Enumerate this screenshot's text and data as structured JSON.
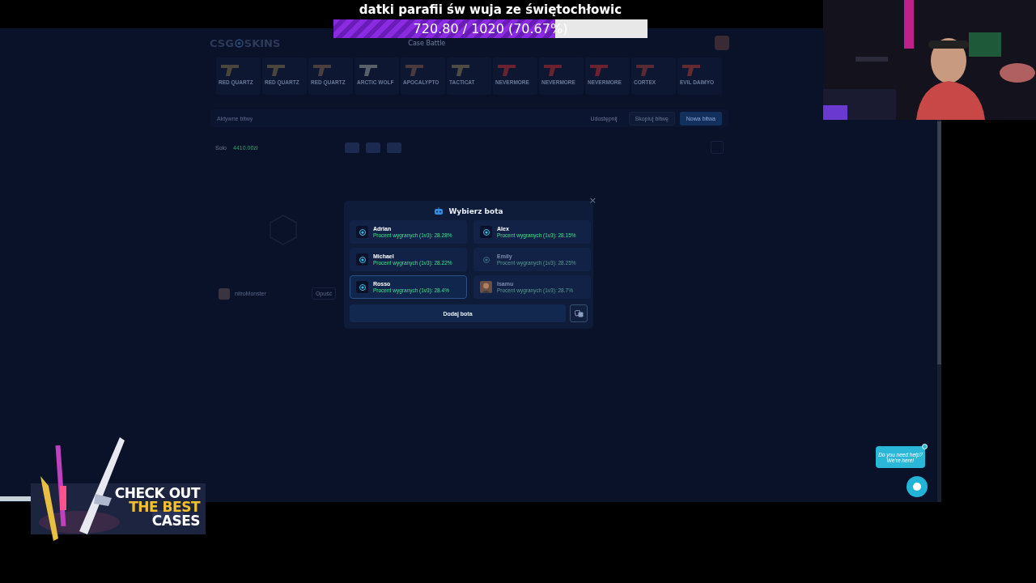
{
  "stream_overlay": {
    "goal_title": "datki parafii św wuja ze świętochłowic",
    "goal_progress": {
      "text": "720.80 / 1020 (70.67%)",
      "level": 0.7067
    }
  },
  "site": {
    "logo": {
      "left": "CSG",
      "right": "SKINS"
    },
    "nav": [
      {
        "label": "Case Battle",
        "selected": true
      }
    ],
    "skins": [
      {
        "name": "RED QUARTZ",
        "color": "#4a463e"
      },
      {
        "name": "RED QUARTZ",
        "color": "#4a463e"
      },
      {
        "name": "RED QUARTZ",
        "color": "#4a3e3e"
      },
      {
        "name": "ARCTIC WOLF",
        "color": "#5a6068"
      },
      {
        "name": "APOCALYPTO",
        "color": "#4a3a3e"
      },
      {
        "name": "TACTICAT",
        "color": "#4e4a44"
      },
      {
        "name": "NEVERMORE",
        "color": "#6a2230"
      },
      {
        "name": "NEVERMORE",
        "color": "#6a2230"
      },
      {
        "name": "NEVERMORE",
        "color": "#6a2230"
      },
      {
        "name": "CORTEX",
        "color": "#5a2a34"
      },
      {
        "name": "EVIL DAIMYO",
        "color": "#642a30"
      }
    ],
    "toolbar": {
      "filters": [
        "Aktywne bitwy"
      ],
      "actions": [
        {
          "label": "Udostępnij",
          "kind": "link"
        },
        {
          "label": "Skopiuj bitwę",
          "kind": "outline"
        },
        {
          "label": "Nowa bitwa",
          "kind": "primary"
        }
      ]
    },
    "battle": {
      "mode": "Solo",
      "total": "4410.00zł",
      "player": {
        "name": "nitroMonster",
        "action": "Opuść"
      }
    }
  },
  "modal": {
    "title": "Wybierz bota",
    "close": "×",
    "add_button": "Dodaj bota",
    "bots": [
      {
        "name": "Adrian",
        "rate": "Procent wygranych (1v3): 28.28%",
        "selected": false,
        "disabled": false,
        "kind": "icon"
      },
      {
        "name": "Alex",
        "rate": "Procent wygranych (1v3): 28.15%",
        "selected": false,
        "disabled": false,
        "kind": "icon"
      },
      {
        "name": "Michael",
        "rate": "Procent wygranych (1v3): 28.22%",
        "selected": false,
        "disabled": false,
        "kind": "icon"
      },
      {
        "name": "Emily",
        "rate": "Procent wygranych (1v3): 28.25%",
        "selected": false,
        "disabled": true,
        "kind": "icon"
      },
      {
        "name": "Rosso",
        "rate": "Procent wygranych (1v3): 28.4%",
        "selected": true,
        "disabled": false,
        "kind": "icon"
      },
      {
        "name": "Isamu",
        "rate": "Procent wygranych (1v3): 28.7%",
        "selected": false,
        "disabled": true
      }
    ]
  },
  "promo": {
    "lines": [
      "CHECK OUT",
      "THE BEST",
      "CASES"
    ]
  },
  "chat": {
    "bubble": [
      "Do you need help?",
      "We're here!"
    ]
  }
}
